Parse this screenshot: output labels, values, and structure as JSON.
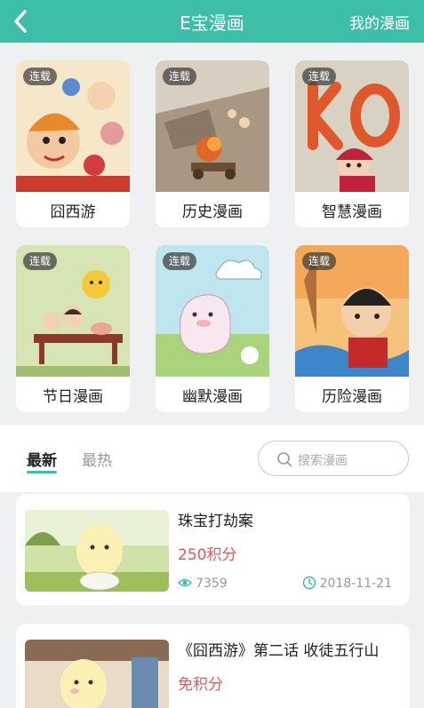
{
  "header": {
    "title": "E宝漫画",
    "my_comic": "我的漫画"
  },
  "accent": "#3cbfa6",
  "categories": [
    {
      "name": "囧西游",
      "badge": "连载"
    },
    {
      "name": "历史漫画",
      "badge": "连载"
    },
    {
      "name": "智慧漫画",
      "badge": "连载"
    },
    {
      "name": "节日漫画",
      "badge": "连载"
    },
    {
      "name": "幽默漫画",
      "badge": "连载"
    },
    {
      "name": "历险漫画",
      "badge": "连载"
    }
  ],
  "tabs": {
    "latest": "最新",
    "hot": "最热"
  },
  "search": {
    "placeholder": "搜索漫画"
  },
  "list": [
    {
      "title": "珠宝打劫案",
      "points": "250积分",
      "views": "7359",
      "date": "2018-11-21"
    },
    {
      "title": "《囧西游》第二话 收徒五行山",
      "points": "免积分",
      "views": "",
      "date": ""
    }
  ]
}
